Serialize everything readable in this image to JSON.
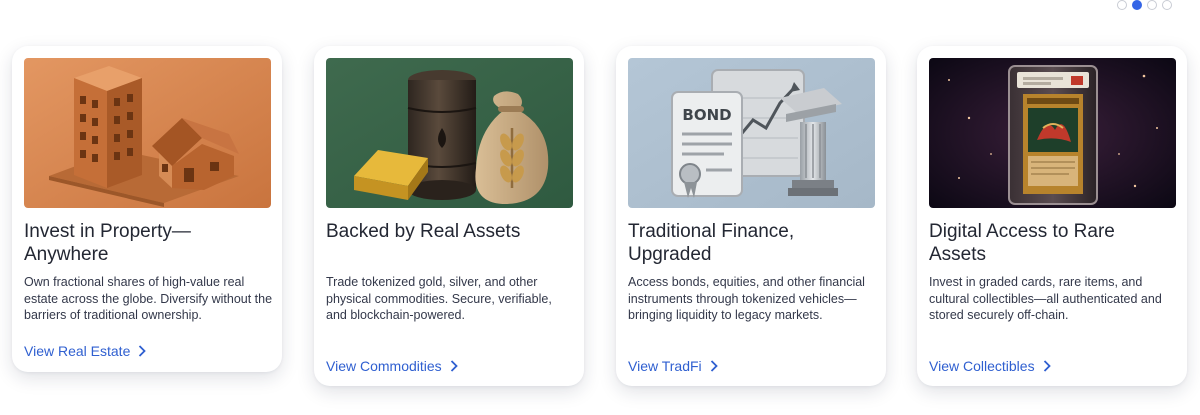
{
  "carousel": {
    "dots": [
      {
        "active": false
      },
      {
        "active": true
      },
      {
        "active": false
      },
      {
        "active": false
      }
    ]
  },
  "cards": [
    {
      "title": "Invest in Property—Anywhere",
      "description": "Own fractional shares of high-value real estate across the globe. Diversify without the barriers of traditional ownership.",
      "link": "View Real Estate",
      "image": "real-estate-illustration"
    },
    {
      "title": "Backed by Real Assets",
      "description": "Trade tokenized gold, silver, and other physical commodities. Secure, verifiable, and blockchain-powered.",
      "link": "View Commodities",
      "image": "commodities-illustration"
    },
    {
      "title": "Traditional Finance, Upgraded",
      "description": "Access bonds, equities, and other financial instruments through tokenized vehicles—bringing liquidity to legacy markets.",
      "link": "View TradFi",
      "image": "tradfi-illustration",
      "bond_label": "BOND"
    },
    {
      "title": "Digital Access to Rare Assets",
      "description": "Invest in graded cards, rare items, and cultural collectibles—all authenticated and stored securely off-chain.",
      "link": "View Collectibles",
      "image": "collectibles-illustration"
    }
  ],
  "colors": {
    "link": "#2f5fd0",
    "dot_active": "#3565e6"
  }
}
